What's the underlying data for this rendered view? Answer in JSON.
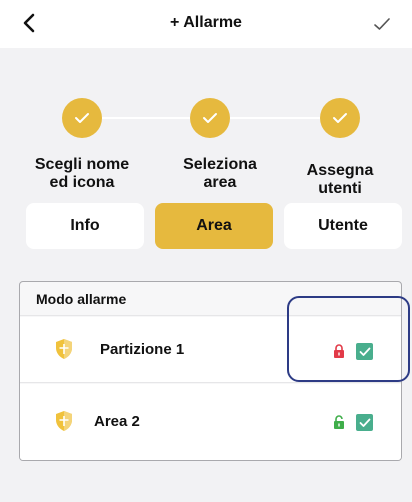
{
  "header": {
    "title": "+ Allarme",
    "back_icon": "chevron-left-icon",
    "confirm_icon": "checkmark-icon"
  },
  "steps": [
    {
      "line1": "Scegli nome",
      "line2": "ed icona",
      "done": true
    },
    {
      "line1": "Seleziona",
      "line2": "area",
      "done": true
    },
    {
      "line1": "Assegna",
      "line2": "utenti",
      "done": true
    }
  ],
  "tabs": [
    {
      "label": "Info",
      "active": false
    },
    {
      "label": "Area",
      "active": true
    },
    {
      "label": "Utente",
      "active": false
    }
  ],
  "card": {
    "header": "Modo allarme",
    "rows": [
      {
        "label": "Partizione 1",
        "lock_state": "locked",
        "checked": true,
        "icon": "shield-icon"
      },
      {
        "label": "Area 2",
        "lock_state": "unlocked",
        "checked": true,
        "icon": "shield-icon"
      }
    ]
  },
  "colors": {
    "accent": "#e6b93e",
    "check": "#49ae8d",
    "lock_locked": "#e23a48",
    "lock_unlocked": "#3fae4a",
    "highlight": "#2d3b85"
  }
}
